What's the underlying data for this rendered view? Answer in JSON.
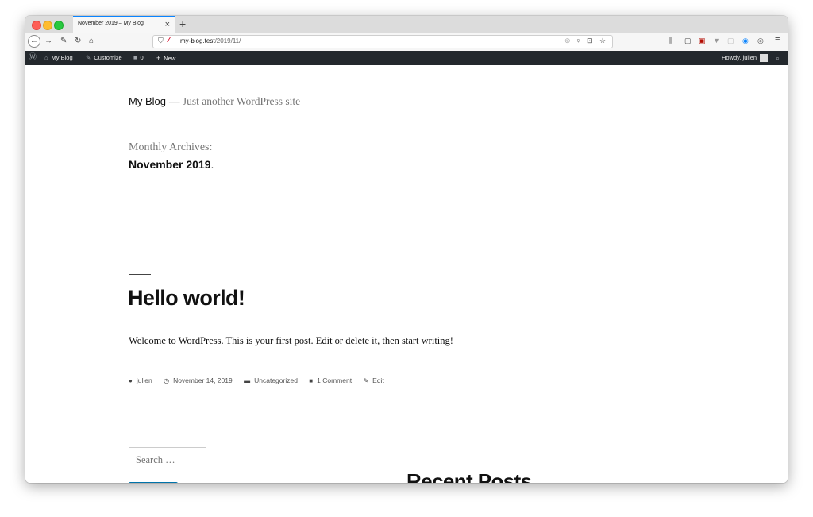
{
  "browser": {
    "tab": {
      "title": "November 2019 – My Blog",
      "close_icon": "×"
    },
    "new_tab_icon": "+",
    "nav": {
      "back": "←",
      "forward": "→",
      "tools": "✎",
      "reload": "↻",
      "home": "⌂"
    },
    "url": {
      "host": "my-blog.test",
      "path": "/2019/11/"
    },
    "url_actions": {
      "more": "···",
      "pocket": "⊚",
      "bulb": "♀",
      "pocket2": "⊡",
      "star": "☆"
    },
    "toolbar": {
      "library": "⫼",
      "sidebar": "▢",
      "pdf": "▣",
      "extension": "▼",
      "extension2": "▢",
      "onepassword": "◉",
      "account": "◎",
      "menu": "≡"
    }
  },
  "adminbar": {
    "wp_logo": "Ⓦ",
    "site_icon": "⌂",
    "site_name": "My Blog",
    "customize_icon": "✎",
    "customize": "Customize",
    "comments_icon": "■",
    "comments_count": "0",
    "new_icon": "+",
    "new_label": "New",
    "howdy": "Howdy, julien",
    "search_icon": "⌕"
  },
  "site": {
    "title": "My Blog",
    "tagline": "— Just another WordPress site"
  },
  "archive": {
    "label": "Monthly Archives:",
    "date": "November 2019",
    "dot": "."
  },
  "post": {
    "title": "Hello world!",
    "excerpt": "Welcome to WordPress. This is your first post. Edit or delete it, then start writing!",
    "meta": {
      "author_icon": "●",
      "author": "julien",
      "date_icon": "◷",
      "date": "November 14, 2019",
      "category_icon": "▬",
      "category": "Uncategorized",
      "comments_icon": "■",
      "comments": "1 Comment",
      "edit_icon": "✎",
      "edit": "Edit"
    }
  },
  "widgets": {
    "search_placeholder": "Search …",
    "recent_posts_title": "Recent Posts"
  }
}
